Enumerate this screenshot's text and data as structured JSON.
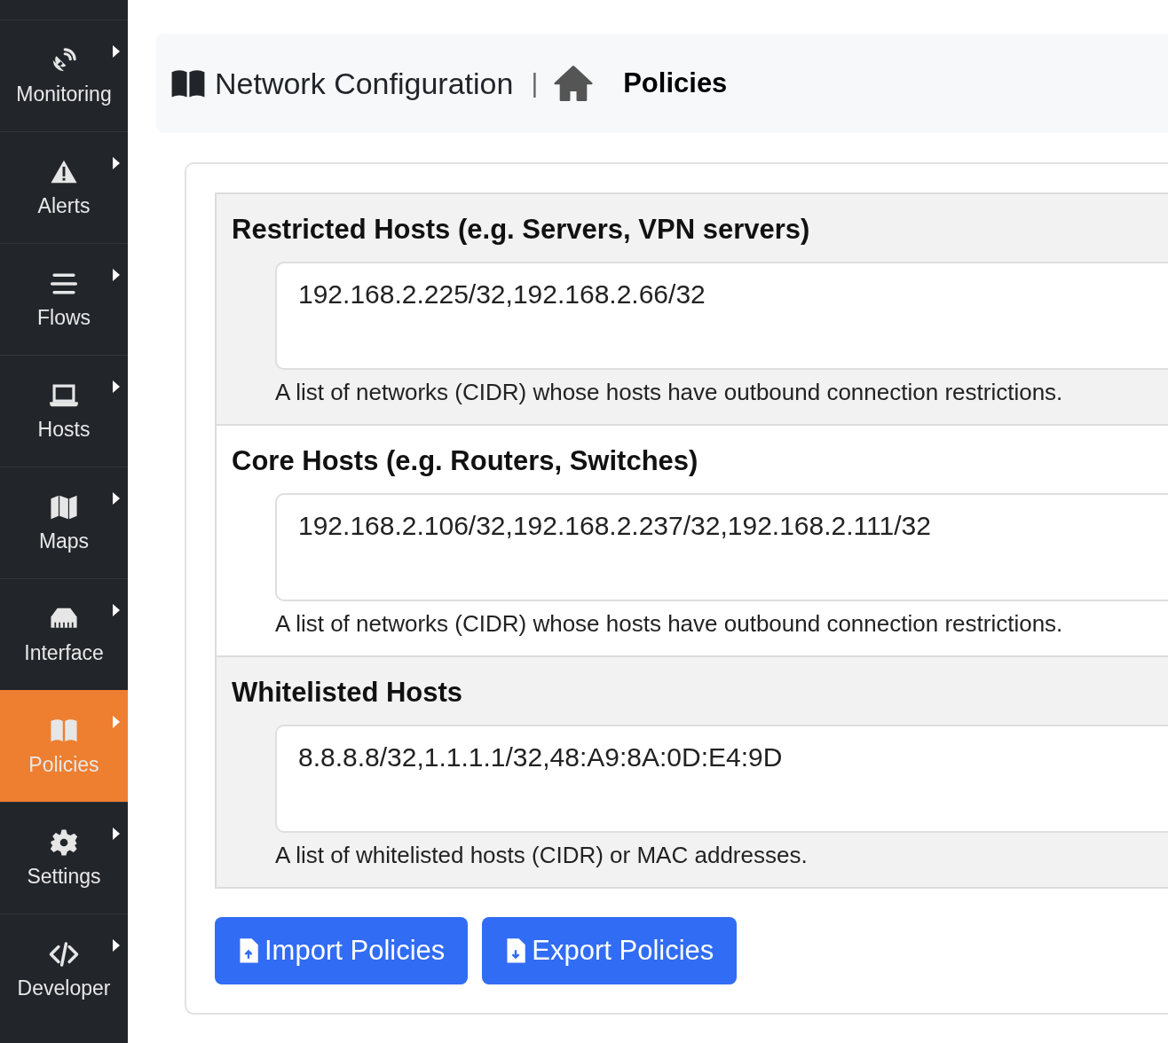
{
  "sidebar": {
    "items": [
      {
        "label": "Monitoring",
        "selected": false
      },
      {
        "label": "Alerts",
        "selected": false
      },
      {
        "label": "Flows",
        "selected": false
      },
      {
        "label": "Hosts",
        "selected": false
      },
      {
        "label": "Maps",
        "selected": false
      },
      {
        "label": "Interface",
        "selected": false
      },
      {
        "label": "Policies",
        "selected": true
      },
      {
        "label": "Settings",
        "selected": false
      },
      {
        "label": "Developer",
        "selected": false
      }
    ]
  },
  "header": {
    "title": "Network Configuration",
    "separator": "|",
    "page": "Policies"
  },
  "sections": [
    {
      "heading": "Restricted Hosts (e.g. Servers, VPN servers)",
      "value": "192.168.2.225/32,192.168.2.66/32",
      "help": "A list of networks (CIDR) whose hosts have outbound connection restrictions."
    },
    {
      "heading": "Core Hosts (e.g. Routers, Switches)",
      "value": "192.168.2.106/32,192.168.2.237/32,192.168.2.111/32",
      "help": "A list of networks (CIDR) whose hosts have outbound connection restrictions."
    },
    {
      "heading": "Whitelisted Hosts",
      "value": "8.8.8.8/32,1.1.1.1/32,48:A9:8A:0D:E4:9D",
      "help": "A list of whitelisted hosts (CIDR) or MAC addresses."
    }
  ],
  "buttons": [
    {
      "label": "Import Policies",
      "kind": "import"
    },
    {
      "label": "Export Policies",
      "kind": "export"
    }
  ]
}
